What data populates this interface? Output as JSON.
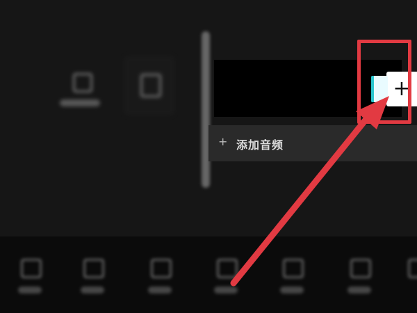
{
  "timeline": {
    "add_clip_symbol": "+",
    "add_audio_icon": "+",
    "add_audio_label": "添加音频"
  },
  "bottom_toolbar": {
    "items": [
      "item-1",
      "item-2",
      "item-3",
      "item-4",
      "item-5",
      "item-6",
      "item-7"
    ]
  },
  "colors": {
    "annotation_red": "#e23a42",
    "clip_accent": "#2bc7cf"
  }
}
